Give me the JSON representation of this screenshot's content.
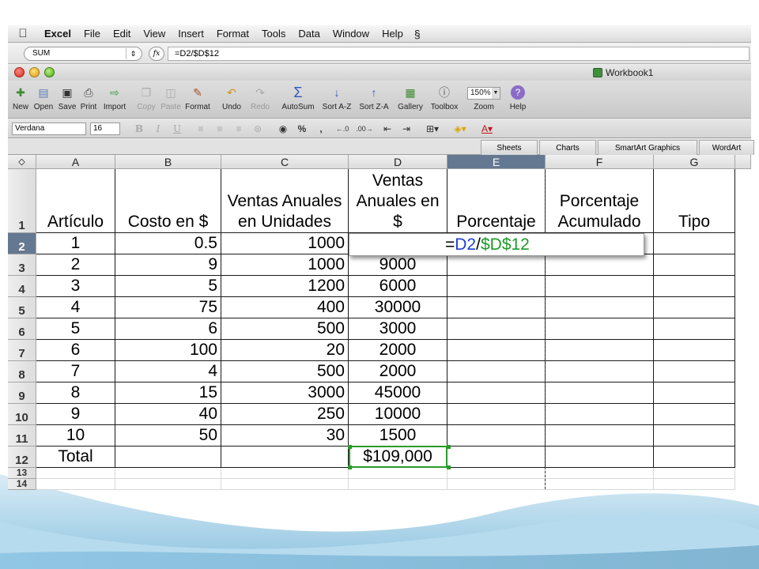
{
  "menubar": {
    "app": "Excel",
    "items": [
      "File",
      "Edit",
      "View",
      "Insert",
      "Format",
      "Tools",
      "Data",
      "Window",
      "Help"
    ]
  },
  "formula_bar": {
    "name_box": "SUM",
    "fx": "fx",
    "formula": "=D2/$D$12"
  },
  "window": {
    "title": "Workbook1"
  },
  "toolbar": {
    "buttons": [
      {
        "label": "New",
        "icon": "new-document-icon",
        "enabled": true
      },
      {
        "label": "Open",
        "icon": "open-folder-icon",
        "enabled": true
      },
      {
        "label": "Save",
        "icon": "save-disk-icon",
        "enabled": true
      },
      {
        "label": "Print",
        "icon": "printer-icon",
        "enabled": true
      },
      {
        "label": "Import",
        "icon": "import-icon",
        "enabled": true
      },
      {
        "label": "Copy",
        "icon": "copy-icon",
        "enabled": false
      },
      {
        "label": "Paste",
        "icon": "paste-icon",
        "enabled": false
      },
      {
        "label": "Format",
        "icon": "format-brush-icon",
        "enabled": true
      },
      {
        "label": "Undo",
        "icon": "undo-icon",
        "enabled": true
      },
      {
        "label": "Redo",
        "icon": "redo-icon",
        "enabled": false
      },
      {
        "label": "AutoSum",
        "icon": "autosum-sigma-icon",
        "enabled": true
      },
      {
        "label": "Sort A-Z",
        "icon": "sort-ascending-icon",
        "enabled": true
      },
      {
        "label": "Sort Z-A",
        "icon": "sort-descending-icon",
        "enabled": true
      },
      {
        "label": "Gallery",
        "icon": "gallery-icon",
        "enabled": true
      },
      {
        "label": "Toolbox",
        "icon": "toolbox-icon",
        "enabled": true
      },
      {
        "label": "Zoom",
        "icon": "zoom-icon",
        "enabled": true
      },
      {
        "label": "Help",
        "icon": "help-icon",
        "enabled": true
      }
    ],
    "zoom_value": "150%"
  },
  "format_bar": {
    "font": "Verdana",
    "size": "16",
    "glyphs": {
      "bold": "B",
      "italic": "I",
      "underline": "U",
      "percent": "%",
      "comma": ",",
      "font_color": "A"
    }
  },
  "ribbon_tabs": [
    "Sheets",
    "Charts",
    "SmartArt Graphics",
    "WordArt"
  ],
  "grid": {
    "columns": [
      "A",
      "B",
      "C",
      "D",
      "E",
      "F",
      "G"
    ],
    "rows": [
      "1",
      "2",
      "3",
      "4",
      "5",
      "6",
      "7",
      "8",
      "9",
      "10",
      "11",
      "12",
      "13",
      "14"
    ],
    "selected_column": "E",
    "selected_row": "2",
    "headers": [
      "Artículo",
      "Costo en $",
      "Ventas Anuales en Unidades",
      "Ventas Anuales en $",
      "Porcentaje",
      "Porcentaje Acumulado",
      "Tipo"
    ],
    "data": [
      [
        "1",
        "0.5",
        "1000",
        ""
      ],
      [
        "2",
        "9",
        "1000",
        "9000"
      ],
      [
        "3",
        "5",
        "1200",
        "6000"
      ],
      [
        "4",
        "75",
        "400",
        "30000"
      ],
      [
        "5",
        "6",
        "500",
        "3000"
      ],
      [
        "6",
        "100",
        "20",
        "2000"
      ],
      [
        "7",
        "4",
        "500",
        "2000"
      ],
      [
        "8",
        "15",
        "3000",
        "45000"
      ],
      [
        "9",
        "40",
        "250",
        "10000"
      ],
      [
        "10",
        "50",
        "30",
        "1500"
      ]
    ],
    "total_label": "Total",
    "total_value": "$109,000",
    "editing": {
      "prefix": "=",
      "ref1": "D2",
      "op": "/",
      "ref2": "$D$12"
    }
  },
  "colors": {
    "selected_header": "#647891",
    "ref1": "#1e3fd6",
    "ref2": "#1d9a2a",
    "slide_wave": "#2e86b8"
  }
}
